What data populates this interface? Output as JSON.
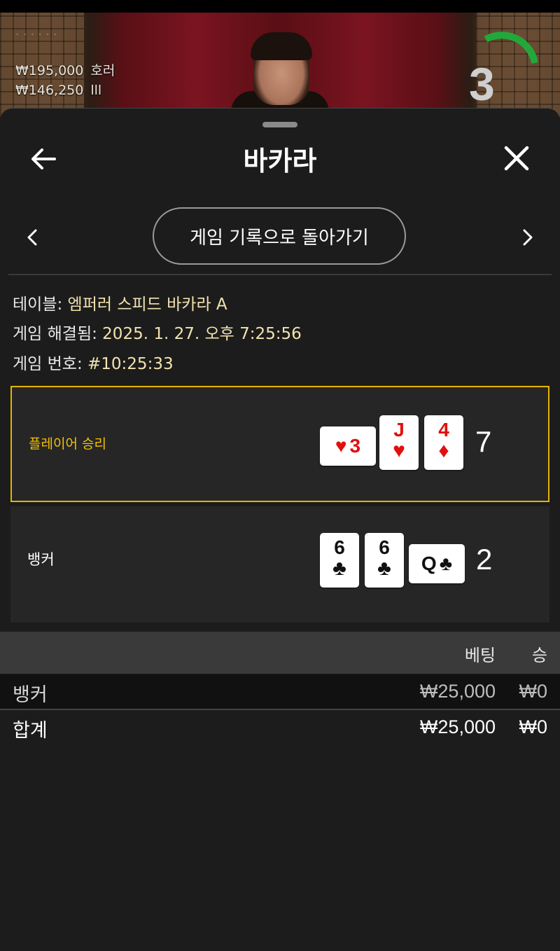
{
  "background_video": {
    "bets": [
      {
        "amount": "₩195,000",
        "name": "호러"
      },
      {
        "amount": "₩146,250",
        "name": "lll"
      }
    ],
    "countdown": "3",
    "countdown_color": "#22a83a"
  },
  "header": {
    "title": "바카라",
    "back_icon": "arrow-left-icon",
    "close_icon": "close-icon"
  },
  "nav": {
    "history_button_label": "게임 기록으로 돌아가기",
    "prev_icon": "chevron-left-icon",
    "next_icon": "chevron-right-icon"
  },
  "details": {
    "table_label": "테이블: ",
    "table_value": "엠퍼러 스피드 바카라 A",
    "resolved_label": "게임 해결됨: ",
    "resolved_value": "2025. 1. 27. 오후 7:25:56",
    "number_label": "게임 번호: ",
    "number_value": "#10:25:33"
  },
  "results": {
    "player": {
      "label": "플레이어 승리",
      "cards": [
        {
          "rank": "3",
          "suit": "♥",
          "color": "red",
          "orientation": "sideways"
        },
        {
          "rank": "J",
          "suit": "♥",
          "color": "red",
          "orientation": "upright"
        },
        {
          "rank": "4",
          "suit": "♦",
          "color": "red",
          "orientation": "upright"
        }
      ],
      "total": "7"
    },
    "banker": {
      "label": "뱅커",
      "cards": [
        {
          "rank": "6",
          "suit": "♣",
          "color": "black",
          "orientation": "upright"
        },
        {
          "rank": "6",
          "suit": "♣",
          "color": "black",
          "orientation": "upright"
        },
        {
          "rank": "Q",
          "suit": "♣",
          "color": "black",
          "orientation": "sideways"
        }
      ],
      "total": "2"
    },
    "win_color": "#e6b400"
  },
  "bets_table": {
    "headers": {
      "bet": "베팅",
      "win": "승"
    },
    "rows": [
      {
        "name": "뱅커",
        "bet": "₩25,000",
        "win": "₩0"
      }
    ],
    "total": {
      "name": "합계",
      "bet": "₩25,000",
      "win": "₩0"
    }
  }
}
